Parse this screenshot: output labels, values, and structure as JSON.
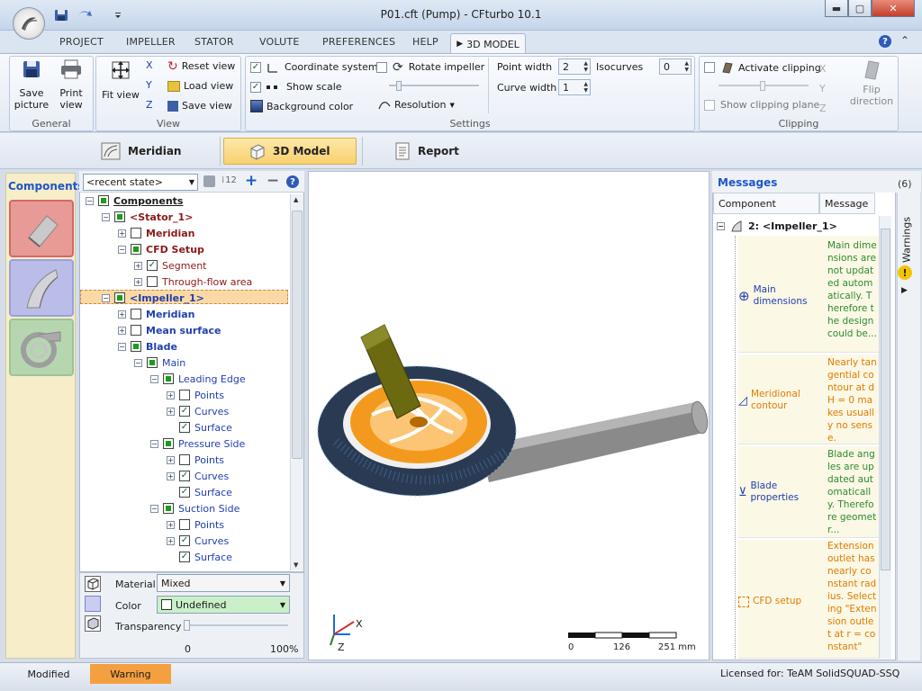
{
  "window": {
    "title": "P01.cft (Pump) - CFturbo 10.1"
  },
  "tabs": [
    "PROJECT",
    "IMPELLER",
    "STATOR",
    "VOLUTE",
    "PREFERENCES",
    "HELP"
  ],
  "active_tab": "3D MODEL",
  "ribbon": {
    "general": {
      "label": "General",
      "save_picture": "Save picture",
      "print_view": "Print view"
    },
    "view": {
      "label": "View",
      "fit_view": "Fit view",
      "reset_view": "Reset view",
      "load_view": "Load view",
      "save_view": "Save view",
      "axis_x": "X",
      "axis_y": "Y",
      "axis_z": "Z"
    },
    "settings": {
      "label": "Settings",
      "coordinate_system": "Coordinate system",
      "show_scale": "Show scale",
      "background_color": "Background color",
      "rotate_impeller": "Rotate impeller",
      "resolution": "Resolution",
      "point_width_label": "Point width",
      "point_width_value": "2",
      "curve_width_label": "Curve width",
      "curve_width_value": "1",
      "isocurves_label": "Isocurves",
      "isocurves_value": "0"
    },
    "clipping": {
      "label": "Clipping",
      "activate_clipping": "Activate clipping",
      "show_clipping_plane": "Show clipping plane",
      "flip_direction": "Flip direction"
    }
  },
  "views": {
    "meridian": "Meridian",
    "model3d": "3D Model",
    "report": "Report"
  },
  "components": {
    "title": "Components"
  },
  "tree": {
    "state": "<recent state>",
    "count_label": "12",
    "items": [
      {
        "label": "Components"
      },
      {
        "label": "<Stator_1>"
      },
      {
        "label": "Meridian"
      },
      {
        "label": "CFD Setup"
      },
      {
        "label": "Segment"
      },
      {
        "label": "Through-flow area"
      },
      {
        "label": "<Impeller_1>"
      },
      {
        "label": "Meridian"
      },
      {
        "label": "Mean surface"
      },
      {
        "label": "Blade"
      },
      {
        "label": "Main"
      },
      {
        "label": "Leading Edge"
      },
      {
        "label": "Points"
      },
      {
        "label": "Curves"
      },
      {
        "label": "Surface"
      },
      {
        "label": "Pressure Side"
      },
      {
        "label": "Points"
      },
      {
        "label": "Curves"
      },
      {
        "label": "Surface"
      },
      {
        "label": "Suction Side"
      },
      {
        "label": "Points"
      },
      {
        "label": "Curves"
      },
      {
        "label": "Surface"
      }
    ]
  },
  "props": {
    "material_label": "Material",
    "material_value": "Mixed",
    "color_label": "Color",
    "color_value": "Undefined",
    "transparency_label": "Transparency",
    "transparency_min": "0",
    "transparency_max": "100%"
  },
  "viewport": {
    "scale": {
      "t0": "0",
      "t1": "126",
      "t2": "251 mm"
    },
    "axis_x": "X",
    "axis_z": "Z"
  },
  "messages": {
    "title": "Messages",
    "count": "(6)",
    "col_component": "Component",
    "col_message": "Message",
    "group": "2: <Impeller_1>",
    "warnings": "Warnings",
    "rows": [
      {
        "component": "Main dimensions",
        "text": "Main dimensions are not updated automatically. Therefore the design could be...",
        "color": "#2e8b2e"
      },
      {
        "component": "Meridional contour",
        "text": "Nearly tangential contour at dH = 0 makes usually no sense.",
        "color": "#e07b00"
      },
      {
        "component": "Blade properties",
        "text": "Blade angles are updated automatically. Therefore geometr...",
        "color": "#2e8b2e"
      },
      {
        "component": "CFD setup",
        "text": "Extension outlet has nearly constant radius. Selecting \"Extension outlet at r = constant\"",
        "color": "#e07b00"
      }
    ]
  },
  "status": {
    "modified": "Modified",
    "warning": "Warning",
    "license": "Licensed for: TeAM SolidSQUAD-SSQ"
  },
  "colors": {
    "warning_bg": "#f5a040",
    "volute_shell": "#2a3a52",
    "impeller": "#f39a1e",
    "pipe": "#8a8a8a",
    "shaft": "#6b6a10"
  }
}
